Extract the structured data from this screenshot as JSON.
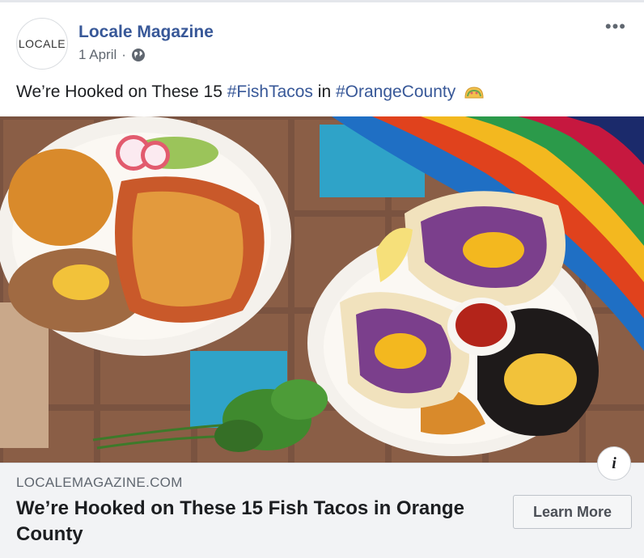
{
  "post": {
    "page_name": "Locale Magazine",
    "avatar_text": "LOCALE",
    "date": "1 April",
    "separator": "·",
    "privacy_icon": "globe-icon",
    "more_icon": "more-options-icon",
    "more_label": "•••"
  },
  "caption": {
    "prefix": "We’re Hooked on These 15 ",
    "hashtag1": "#FishTacos",
    "middle": " in ",
    "hashtag2": "#OrangeCounty",
    "emoji_icon": "taco-icon"
  },
  "image": {
    "description_icon": "food-photo"
  },
  "link_preview": {
    "domain": "LOCALEMAGAZINE.COM",
    "title": "We’re Hooked on These 15 Fish Tacos in Orange County",
    "cta_label": "Learn More",
    "info_label": "i"
  },
  "colors": {
    "link_blue": "#385898",
    "footer_bg": "#f2f3f5",
    "meta_gray": "#606770"
  }
}
